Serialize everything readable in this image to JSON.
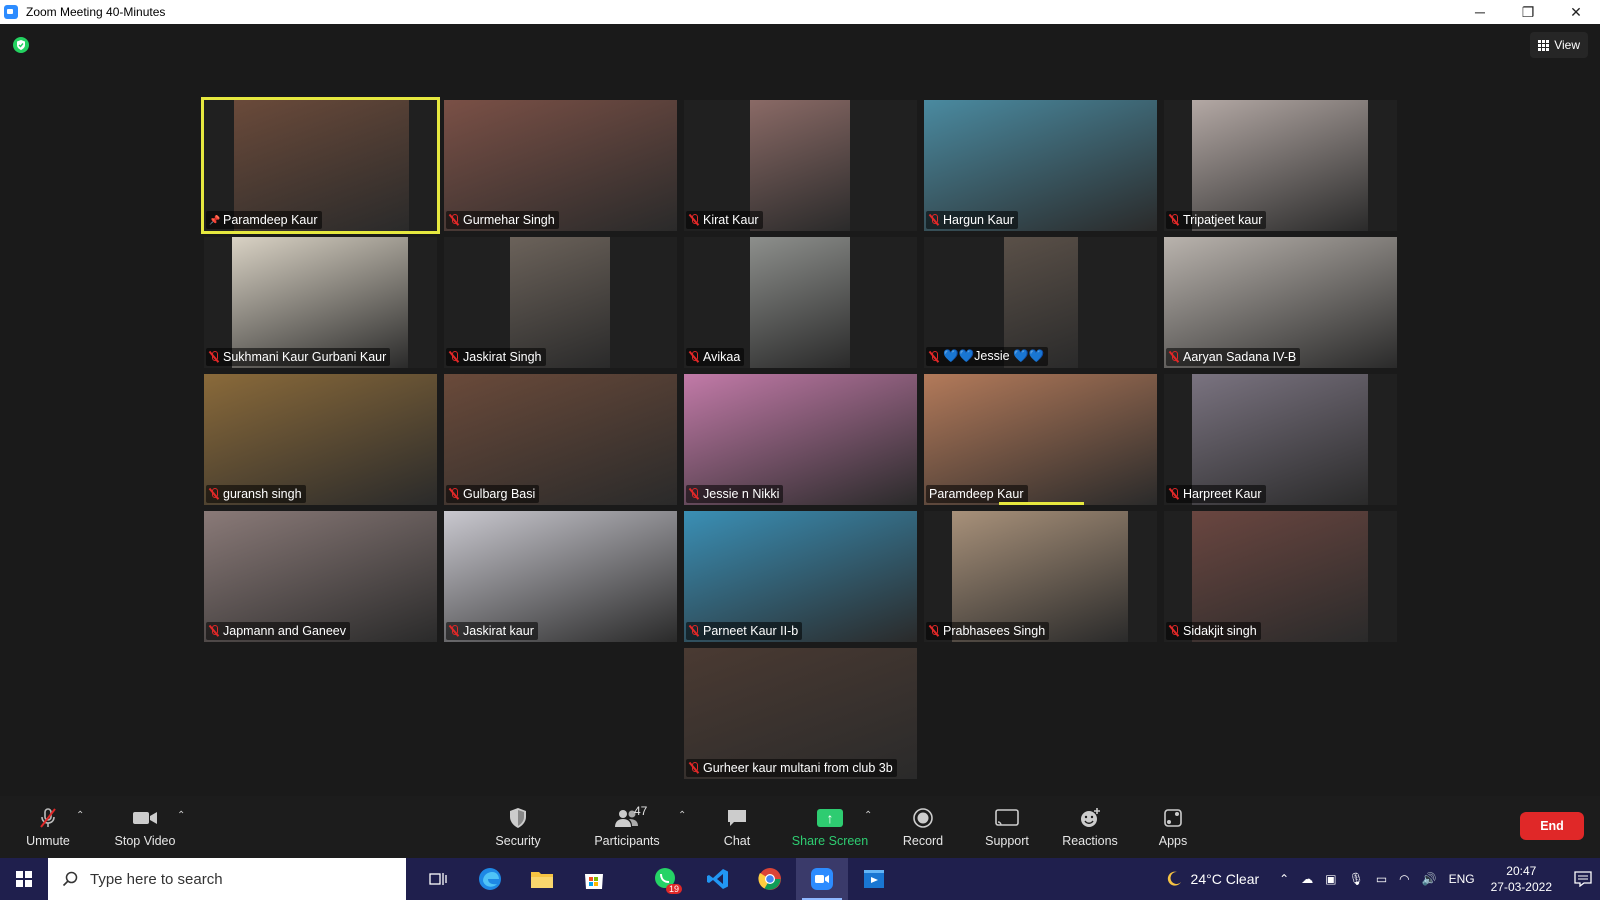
{
  "window": {
    "title": "Zoom Meeting 40-Minutes",
    "minimize": "─",
    "restore": "❐",
    "close": "✕"
  },
  "meeting": {
    "view_label": "View",
    "participants": [
      {
        "name": "Paramdeep Kaur",
        "status": "pinned",
        "active": true,
        "bg": "#6a4a3a"
      },
      {
        "name": "Gurmehar Singh",
        "status": "muted",
        "bg": "#7a5046"
      },
      {
        "name": "Kirat Kaur",
        "status": "muted",
        "bg": "#8a6a66"
      },
      {
        "name": "Hargun Kaur",
        "status": "muted",
        "bg": "#4a8aa0"
      },
      {
        "name": "Tripatjeet kaur",
        "status": "muted",
        "bg": "#b3a8a4"
      },
      {
        "name": "Sukhmani Kaur Gurbani Kaur",
        "status": "muted",
        "bg": "#d9d2c4"
      },
      {
        "name": "Jaskirat Singh",
        "status": "muted",
        "bg": "#6b625a"
      },
      {
        "name": "Avikaa",
        "status": "muted",
        "bg": "#8d8f8c"
      },
      {
        "name": "💙💙Jessie 💙💙",
        "status": "muted",
        "bg": "#5a5048"
      },
      {
        "name": "Aaryan Sadana IV-B",
        "status": "muted",
        "bg": "#b9b3ad"
      },
      {
        "name": "guransh singh",
        "status": "muted",
        "bg": "#8a6a3a"
      },
      {
        "name": "Gulbarg Basi",
        "status": "muted",
        "bg": "#6a4a3a"
      },
      {
        "name": "Jessie n Nikki",
        "status": "muted",
        "bg": "#c27aa8"
      },
      {
        "name": "Paramdeep Kaur",
        "status": "speaking",
        "bg": "#b37a5a"
      },
      {
        "name": "Harpreet Kaur",
        "status": "muted",
        "bg": "#7a7380"
      },
      {
        "name": "Japmann and Ganeev",
        "status": "muted",
        "bg": "#8a7a78"
      },
      {
        "name": "Jaskirat kaur",
        "status": "muted",
        "bg": "#c9c8cf"
      },
      {
        "name": "Parneet Kaur II-b",
        "status": "muted",
        "bg": "#3a8fb5"
      },
      {
        "name": "Prabhasees Singh",
        "status": "muted",
        "bg": "#a8917a"
      },
      {
        "name": "Sidakjit singh",
        "status": "muted",
        "bg": "#6a4640"
      },
      {
        "name": "Gurheer kaur multani from club 3b",
        "status": "muted",
        "bg": "#4a3a32"
      }
    ]
  },
  "toolbar": {
    "unmute": "Unmute",
    "stop_video": "Stop Video",
    "security": "Security",
    "participants": "Participants",
    "participants_count": "47",
    "chat": "Chat",
    "share_screen": "Share Screen",
    "record": "Record",
    "support": "Support",
    "reactions": "Reactions",
    "apps": "Apps",
    "end": "End"
  },
  "taskbar": {
    "search_placeholder": "Type here to search",
    "whatsapp_badge": "19",
    "weather": "24°C  Clear",
    "language": "ENG",
    "time": "20:47",
    "date": "27-03-2022"
  },
  "colors": {
    "active_speaker": "#e6e83f",
    "end_button": "#e02828",
    "share_green": "#2ecc71",
    "taskbar": "#1f1f4d"
  }
}
